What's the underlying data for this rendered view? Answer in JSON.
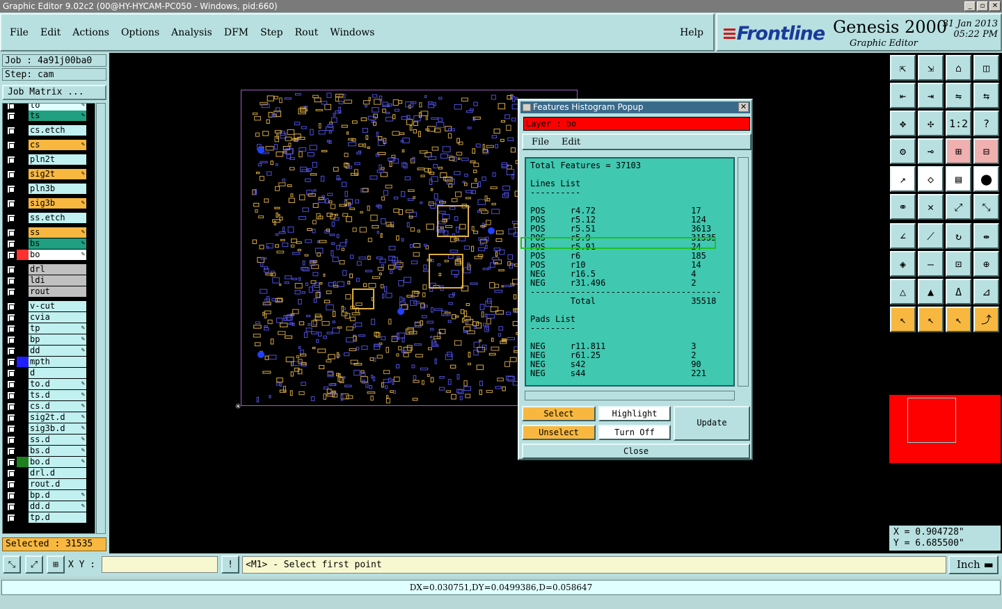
{
  "window": {
    "title": "Graphic Editor 9.02c2 (00@HY-HYCAM-PC050 - Windows, pid:660)"
  },
  "menu": {
    "items": [
      "File",
      "Edit",
      "Actions",
      "Options",
      "Analysis",
      "DFM",
      "Step",
      "Rout",
      "Windows"
    ],
    "help": "Help"
  },
  "logo": {
    "brand": "Frontline",
    "product": "Genesis 2000",
    "subtitle": "Graphic Editor",
    "date": "31 Jan 2013",
    "time": "05:22 PM"
  },
  "job": {
    "job": "Job : 4a91j00ba0",
    "step": "Step: cam",
    "matrix": "Job Matrix ..."
  },
  "layers": [
    {
      "name": "to",
      "color": "#e0ffff",
      "swatch": "#000",
      "pen": true
    },
    {
      "name": "ts",
      "color": "#20a080",
      "swatch": "#000",
      "pen": true
    },
    {
      "name": "cs.etch",
      "color": "#c0f0f0",
      "swatch": "#000",
      "pen": false
    },
    {
      "name": "cs",
      "color": "#f8b840",
      "swatch": "#000",
      "pen": true
    },
    {
      "name": "pln2t",
      "color": "#c0f0f0",
      "swatch": "#000",
      "pen": false
    },
    {
      "name": "sig2t",
      "color": "#f8b840",
      "swatch": "#000",
      "pen": true
    },
    {
      "name": "pln3b",
      "color": "#c0f0f0",
      "swatch": "#000",
      "pen": false
    },
    {
      "name": "sig3b",
      "color": "#f8b840",
      "swatch": "#000",
      "pen": true
    },
    {
      "name": "ss.etch",
      "color": "#c0f0f0",
      "swatch": "#000",
      "pen": false
    },
    {
      "name": "ss",
      "color": "#f8b840",
      "swatch": "#000",
      "pen": true
    },
    {
      "name": "bs",
      "color": "#20a080",
      "swatch": "#000",
      "pen": true
    },
    {
      "name": "bo",
      "color": "#ffffff",
      "swatch": "#ff3030",
      "pen": true
    },
    {
      "name": "drl",
      "color": "#c0c0c0",
      "swatch": "#000",
      "pen": false
    },
    {
      "name": "ldi",
      "color": "#c0c0c0",
      "swatch": "#000",
      "pen": false
    },
    {
      "name": "rout",
      "color": "#c0c0c0",
      "swatch": "#000",
      "pen": false
    },
    {
      "name": "v-cut",
      "color": "#c0f0f0",
      "swatch": "#000",
      "pen": false
    },
    {
      "name": "cvia",
      "color": "#c0f0f0",
      "swatch": "#000",
      "pen": false
    },
    {
      "name": "tp",
      "color": "#c0f0f0",
      "swatch": "#000",
      "pen": true
    },
    {
      "name": "bp",
      "color": "#c0f0f0",
      "swatch": "#000",
      "pen": true
    },
    {
      "name": "dd",
      "color": "#c0f0f0",
      "swatch": "#000",
      "pen": true
    },
    {
      "name": "mpth",
      "color": "#c0f0f0",
      "swatch": "#2020ff",
      "pen": false
    },
    {
      "name": "d",
      "color": "#c0f0f0",
      "swatch": "#000",
      "pen": false
    },
    {
      "name": "to.d",
      "color": "#c0f0f0",
      "swatch": "#000",
      "pen": true
    },
    {
      "name": "ts.d",
      "color": "#c0f0f0",
      "swatch": "#000",
      "pen": true
    },
    {
      "name": "cs.d",
      "color": "#c0f0f0",
      "swatch": "#000",
      "pen": true
    },
    {
      "name": "sig2t.d",
      "color": "#c0f0f0",
      "swatch": "#000",
      "pen": true
    },
    {
      "name": "sig3b.d",
      "color": "#c0f0f0",
      "swatch": "#000",
      "pen": true
    },
    {
      "name": "ss.d",
      "color": "#c0f0f0",
      "swatch": "#000",
      "pen": true
    },
    {
      "name": "bs.d",
      "color": "#c0f0f0",
      "swatch": "#000",
      "pen": true
    },
    {
      "name": "bo.d",
      "color": "#c0f0f0",
      "swatch": "#208020",
      "pen": true
    },
    {
      "name": "drl.d",
      "color": "#c0f0f0",
      "swatch": "#000",
      "pen": false
    },
    {
      "name": "rout.d",
      "color": "#c0f0f0",
      "swatch": "#000",
      "pen": false
    },
    {
      "name": "bp.d",
      "color": "#c0f0f0",
      "swatch": "#000",
      "pen": true
    },
    {
      "name": "dd.d",
      "color": "#c0f0f0",
      "swatch": "#000",
      "pen": true
    },
    {
      "name": "tp.d",
      "color": "#c0f0f0",
      "swatch": "#000",
      "pen": false
    }
  ],
  "selected": "Selected : 31535",
  "popup": {
    "title": "Features Histogram Popup",
    "layer_label": "Layer :  bo",
    "menu": [
      "File",
      "Edit"
    ],
    "lines": [
      "Total Features = 37103",
      "",
      "Lines List",
      "----------",
      "",
      "POS     r4.72                   17",
      "POS     r5.12                   124",
      "POS     r5.51                   3613",
      "POS     r5.9                    31535",
      "POS     r5.91                   24",
      "POS     r6                      185",
      "POS     r10                     14",
      "NEG     r16.5                   4",
      "NEG     r31.496                 2",
      "--------------------------------------",
      "        Total                   35518",
      "",
      "Pads List",
      "---------",
      "",
      "NEG     r11.811                 3",
      "NEG     r61.25                  2",
      "NEG     s42                     90",
      "NEG     s44                     221"
    ],
    "buttons": {
      "select": "Select",
      "highlight": "Highlight",
      "update": "Update",
      "unselect": "Unselect",
      "turn_off": "Turn Off",
      "close": "Close"
    }
  },
  "coords": {
    "x": "X = 0.904728\"",
    "y": "Y = 6.685500\""
  },
  "bottom": {
    "xy_label": "X Y :",
    "xy_value": "",
    "prompt": "<M1> - Select first point",
    "unit": "Inch"
  },
  "status": "DX=0.030751,DY=0.0499386,D=0.058647"
}
